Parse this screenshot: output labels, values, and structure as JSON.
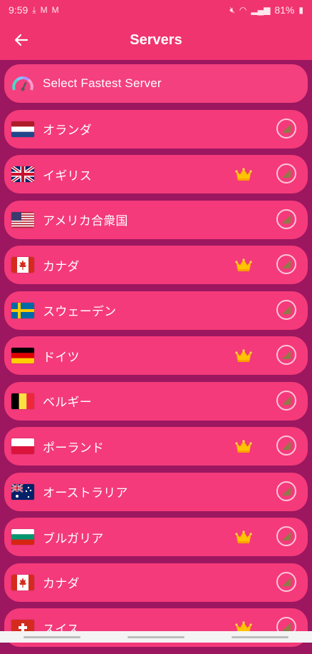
{
  "status_bar": {
    "time": "9:59",
    "battery": "81%"
  },
  "app_bar": {
    "title": "Servers",
    "back_icon": "arrow-left-icon"
  },
  "fastest": {
    "label": "Select Fastest Server",
    "icon": "speedometer-icon"
  },
  "servers": [
    {
      "name": "オランダ",
      "flag": "nl",
      "premium": false
    },
    {
      "name": "イギリス",
      "flag": "gb",
      "premium": true
    },
    {
      "name": "アメリカ合衆国",
      "flag": "us",
      "premium": false
    },
    {
      "name": "カナダ",
      "flag": "ca",
      "premium": true
    },
    {
      "name": "スウェーデン",
      "flag": "se",
      "premium": false
    },
    {
      "name": "ドイツ",
      "flag": "de",
      "premium": true
    },
    {
      "name": "ベルギー",
      "flag": "be",
      "premium": false
    },
    {
      "name": "ポーランド",
      "flag": "pl",
      "premium": true
    },
    {
      "name": "オーストラリア",
      "flag": "au",
      "premium": false
    },
    {
      "name": "ブルガリア",
      "flag": "bg",
      "premium": true
    },
    {
      "name": "カナダ",
      "flag": "ca",
      "premium": false
    },
    {
      "name": "スイス",
      "flag": "ch",
      "premium": true
    }
  ],
  "colors": {
    "background": "#9c1760",
    "app_bar": "#f0346f",
    "row": "#f43a7a",
    "crown": "#ffc400",
    "signal": "#8f7a48"
  }
}
